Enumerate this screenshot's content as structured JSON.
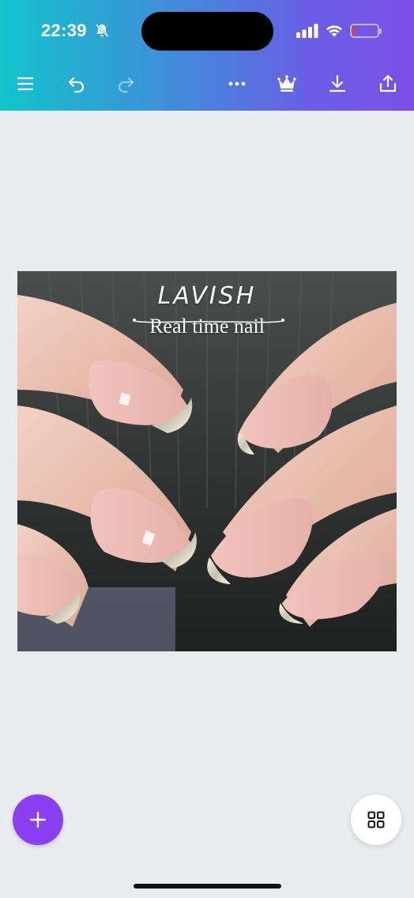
{
  "status_bar": {
    "time": "22:39",
    "battery_level": 0.12,
    "battery_color": "#ff3b30"
  },
  "toolbar": {
    "icons": [
      "menu-icon",
      "undo-icon",
      "redo-icon",
      "more-icon",
      "crown-icon",
      "download-icon",
      "share-icon"
    ],
    "accent_gradient": [
      "#12c4cc",
      "#7b4fe6"
    ]
  },
  "canvas": {
    "image_title": "LAVISH",
    "image_subtitle": "Real time nail"
  },
  "fabs": {
    "add_icon": "plus-icon",
    "add_color": "#8a3ff0",
    "grid_icon": "grid-icon"
  }
}
